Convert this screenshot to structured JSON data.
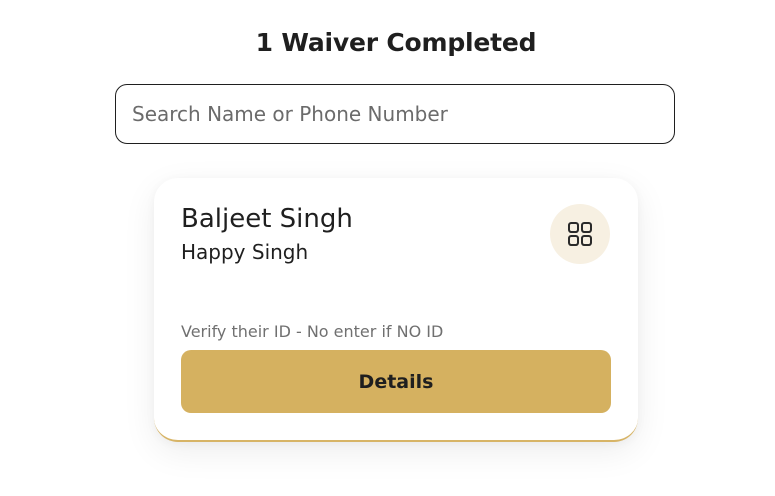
{
  "header": {
    "title": "1 Waiver Completed"
  },
  "search": {
    "placeholder": "Search Name or Phone Number",
    "value": ""
  },
  "waiver_card": {
    "name": "Baljeet Singh",
    "subname": "Happy Singh",
    "grid_icon": "grid-icon",
    "verify_note": "Verify their ID - No enter if NO ID",
    "details_label": "Details"
  },
  "colors": {
    "accent": "#d5b160",
    "icon_circle_bg": "#f7f0e2",
    "text": "#1f1f1f",
    "muted_text": "#707070"
  }
}
